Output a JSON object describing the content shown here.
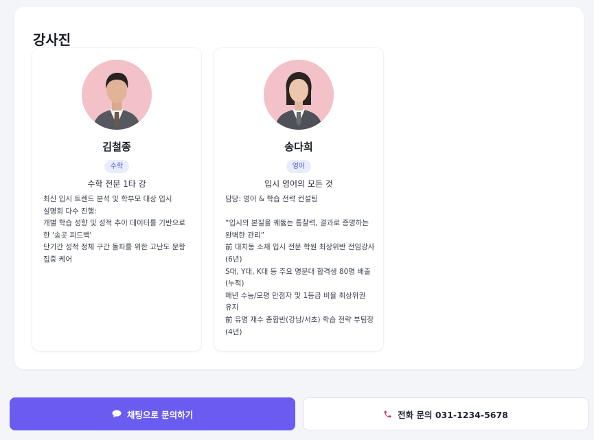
{
  "section": {
    "title": "강사진"
  },
  "instructors": [
    {
      "name": "김철종",
      "subject": "수학",
      "tagline": "수학 전문 1타 강",
      "description": [
        "최신 입시 트렌드 분석 및 학부모 대상 입시 설명회 다수 진행:",
        "개별 학습 성향 및 성적 추이 데이터를 기반으로 한 '송곳 피드백'",
        "단기간 성적 정체 구간 돌파를 위한 고난도 문항 집중 케어"
      ]
    },
    {
      "name": "송다희",
      "subject": "영어",
      "tagline": "입시 영어의 모든 것",
      "description": [
        "담당: 영어 & 학습 전략 컨설팅",
        "",
        "“입시의 본질을 꿰뚫는 통찰력, 결과로 증명하는 완벽한 관리”",
        "前 대치동 소재 입시 전문 학원 최상위반 전임강사 (6년)",
        "S대, Y대, K대 등 주요 명문대 합격생 80명 배출 (누적)",
        "매년 수능/모평 만점자 및 1등급 비율 최상위권 유지",
        "前 유명 재수 종합반(강남/서초) 학습 전략 부팀장 (4년)"
      ]
    }
  ],
  "actions": {
    "chat_label": "채팅으로 문의하기",
    "call_label": "전화 문의 031-1234-5678"
  },
  "icons": {
    "chat": "chat-bubble-icon",
    "call": "phone-icon"
  },
  "colors": {
    "primary": "#6a5cf0",
    "badge_bg": "#e9ecfb",
    "badge_text": "#4a58c8",
    "avatar_bg": "#f3c2c8",
    "phone": "#d6336c"
  }
}
